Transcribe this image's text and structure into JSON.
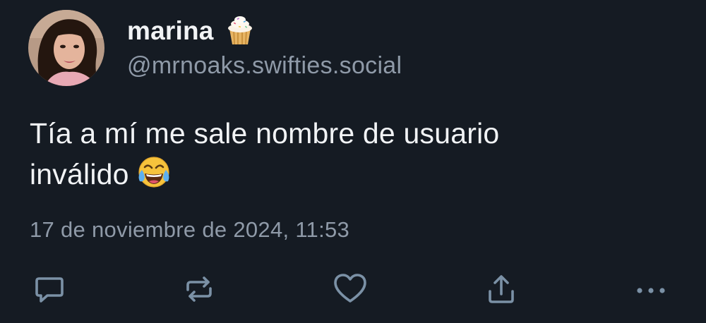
{
  "post": {
    "author": {
      "display_name": "marina",
      "name_emoji": "cupcake-emoji",
      "handle": "@mrnoaks.swifties.social"
    },
    "text_line1": "Tía a mí me sale nombre de usuario",
    "text_line2": "inválido",
    "text_emoji": "face-with-tears-of-joy-emoji",
    "timestamp": "17 de noviembre de 2024, 11:53"
  },
  "actions": [
    {
      "name": "reply",
      "icon": "reply-icon"
    },
    {
      "name": "repost",
      "icon": "repost-icon"
    },
    {
      "name": "like",
      "icon": "heart-icon"
    },
    {
      "name": "share",
      "icon": "share-icon"
    },
    {
      "name": "more",
      "icon": "more-icon"
    }
  ],
  "colors": {
    "background": "#151b23",
    "text": "#f1f3f5",
    "muted": "#8f9aa8",
    "icon": "#7b91a6"
  }
}
